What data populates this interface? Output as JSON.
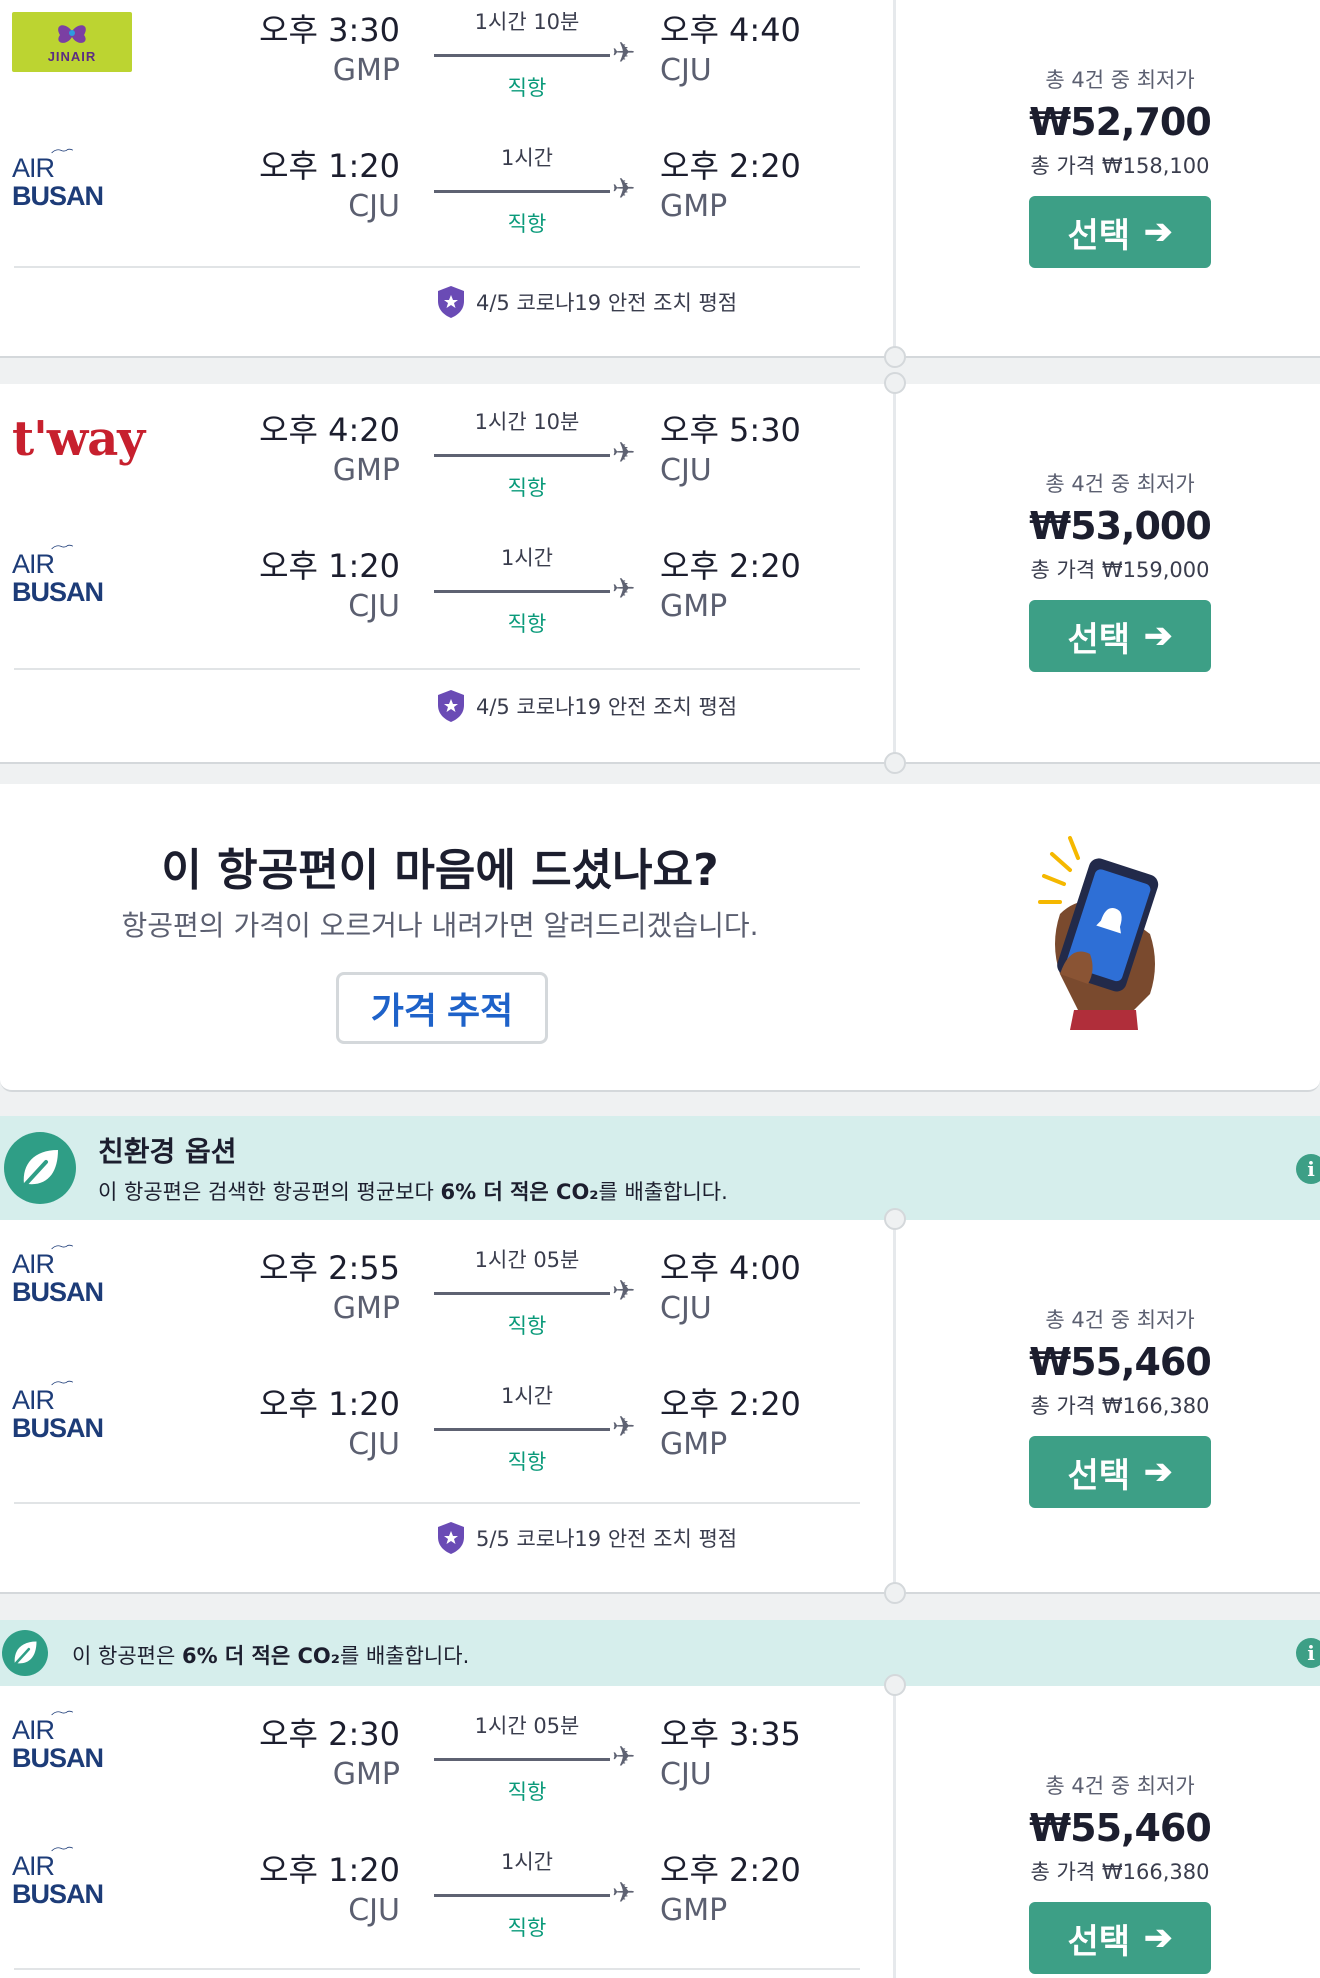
{
  "cards": [
    {
      "legs": [
        {
          "airline": "JINAIR",
          "logo": "jinair-logo",
          "dep_time": "오후 3:30",
          "dep_code": "GMP",
          "duration": "1시간 10분",
          "stop": "직항",
          "arr_time": "오후 4:40",
          "arr_code": "CJU"
        },
        {
          "airline": "AIR BUSAN",
          "logo": "airbusan-logo",
          "dep_time": "오후 1:20",
          "dep_code": "CJU",
          "duration": "1시간",
          "stop": "직항",
          "arr_time": "오후 2:20",
          "arr_code": "GMP"
        }
      ],
      "safety": "4/5 코로나19 안전 조치 평점",
      "price_label": "총 4건 중 최저가",
      "price": "₩52,700",
      "total": "총 가격 ₩158,100",
      "select": "선택"
    },
    {
      "legs": [
        {
          "airline": "t'way",
          "logo": "tway-logo",
          "dep_time": "오후 4:20",
          "dep_code": "GMP",
          "duration": "1시간 10분",
          "stop": "직항",
          "arr_time": "오후 5:30",
          "arr_code": "CJU"
        },
        {
          "airline": "AIR BUSAN",
          "logo": "airbusan-logo",
          "dep_time": "오후 1:20",
          "dep_code": "CJU",
          "duration": "1시간",
          "stop": "직항",
          "arr_time": "오후 2:20",
          "arr_code": "GMP"
        }
      ],
      "safety": "4/5 코로나19 안전 조치 평점",
      "price_label": "총 4건 중 최저가",
      "price": "₩53,000",
      "total": "총 가격 ₩159,000",
      "select": "선택"
    },
    {
      "legs": [
        {
          "airline": "AIR BUSAN",
          "logo": "airbusan-logo",
          "dep_time": "오후 2:55",
          "dep_code": "GMP",
          "duration": "1시간 05분",
          "stop": "직항",
          "arr_time": "오후 4:00",
          "arr_code": "CJU"
        },
        {
          "airline": "AIR BUSAN",
          "logo": "airbusan-logo",
          "dep_time": "오후 1:20",
          "dep_code": "CJU",
          "duration": "1시간",
          "stop": "직항",
          "arr_time": "오후 2:20",
          "arr_code": "GMP"
        }
      ],
      "safety": "5/5 코로나19 안전 조치 평점",
      "price_label": "총 4건 중 최저가",
      "price": "₩55,460",
      "total": "총 가격 ₩166,380",
      "select": "선택"
    },
    {
      "legs": [
        {
          "airline": "AIR BUSAN",
          "logo": "airbusan-logo",
          "dep_time": "오후 2:30",
          "dep_code": "GMP",
          "duration": "1시간 05분",
          "stop": "직항",
          "arr_time": "오후 3:35",
          "arr_code": "CJU"
        },
        {
          "airline": "AIR BUSAN",
          "logo": "airbusan-logo",
          "dep_time": "오후 1:20",
          "dep_code": "CJU",
          "duration": "1시간",
          "stop": "직항",
          "arr_time": "오후 2:20",
          "arr_code": "GMP"
        }
      ],
      "price_label": "총 4건 중 최저가",
      "price": "₩55,460",
      "total": "총 가격 ₩166,380",
      "select": "선택"
    }
  ],
  "promo": {
    "title": "이 항공편이 마음에 드셨나요?",
    "subtitle": "항공편의 가격이 오르거나 내려가면 알려드리겠습니다.",
    "button": "가격 추적"
  },
  "eco_full": {
    "title": "친환경 옵션",
    "text_pre": "이 항공편은 검색한 항공편의 평균보다 ",
    "text_bold": "6% 더 적은 CO₂",
    "text_post": "를 배출합니다."
  },
  "eco_short": {
    "text_pre": "이 항공편은 ",
    "text_bold": "6% 더 적은 CO₂",
    "text_post": "를 배출합니다."
  },
  "colors": {
    "accent_green": "#3d9f86",
    "direct_green": "#0a9a7a",
    "eco_bg": "#d6eeec",
    "track_blue": "#1e62c9"
  }
}
